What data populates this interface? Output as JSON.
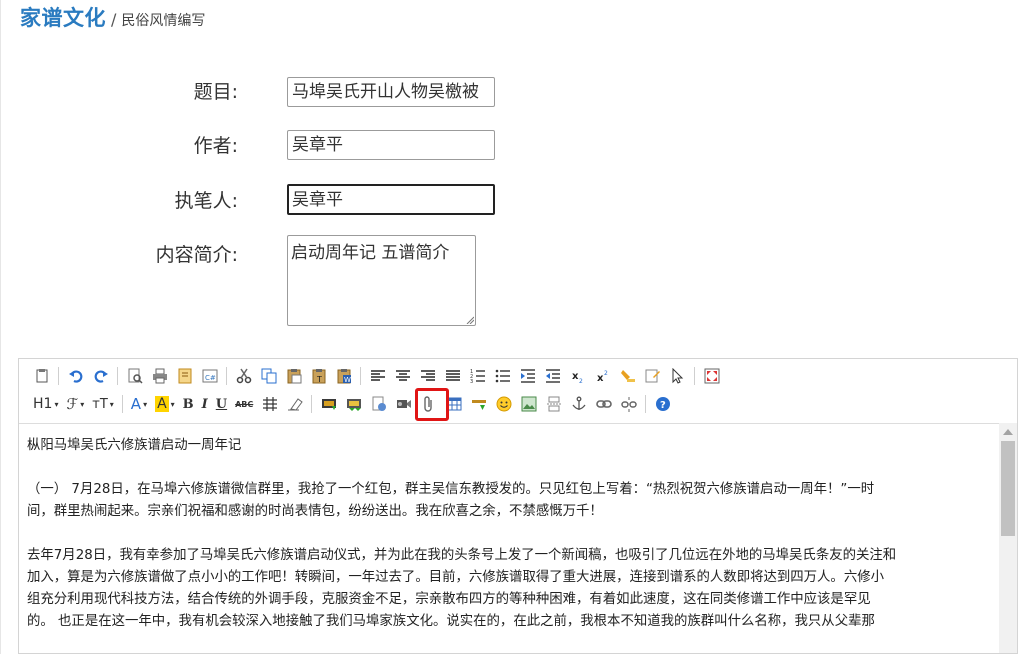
{
  "header": {
    "brand": "家谱文化",
    "separator": "/",
    "crumb": "民俗风情编写"
  },
  "form": {
    "title_label": "题目:",
    "title_value": "马埠吴氏开山人物吴檄被",
    "author_label": "作者:",
    "author_value": "吴章平",
    "writer_label": "执笔人:",
    "writer_value": "吴章平",
    "summary_label": "内容简介:",
    "summary_value": "启动周年记 五谱简介"
  },
  "toolbar": {
    "heading_label": "H1",
    "font_family_label": "ℱ",
    "font_size_label": "тT",
    "font_color_label": "A",
    "bg_color_label": "A",
    "bold_label": "B",
    "italic_label": "I",
    "underline_label": "U",
    "strike_label": "ABC",
    "highlighted_tool": "insert-image-button",
    "accent_color": "#e01515"
  },
  "document": {
    "p1": "枞阳马埠吴氏六修族谱启动一周年记",
    "p2a": "（一） 7月28日，在马埠六修族谱微信群里，我抢了一个红包，群主吴信东教授发的。只见红包上写着：“热烈祝贺六修族谱启动一周年！”一时",
    "p2b": "间，群里热闹起来。宗亲们祝福和感谢的时尚表情包，纷纷送出。我在欣喜之余，不禁感慨万千！",
    "p3a": "去年7月28日，我有幸参加了马埠吴氏六修族谱启动仪式，并为此在我的头条号上发了一个新闻稿，也吸引了几位远在外地的马埠吴氏条友的关注和",
    "p3b": "加入，算是为六修族谱做了点小小的工作吧！转瞬间，一年过去了。目前，六修族谱取得了重大进展，连接到谱系的人数即将达到四万人。六修小",
    "p3c": "组充分利用现代科技方法，结合传统的外调手段，克服资金不足，宗亲散布四方的等种种困难，有着如此速度，这在同类修谱工作中应该是罕见",
    "p3d": "的。 也正是在这一年中，我有机会较深入地接触了我们马埠家族文化。说实在的，在此之前，我根本不知道我的族群叫什么名称，我只从父辈那"
  }
}
